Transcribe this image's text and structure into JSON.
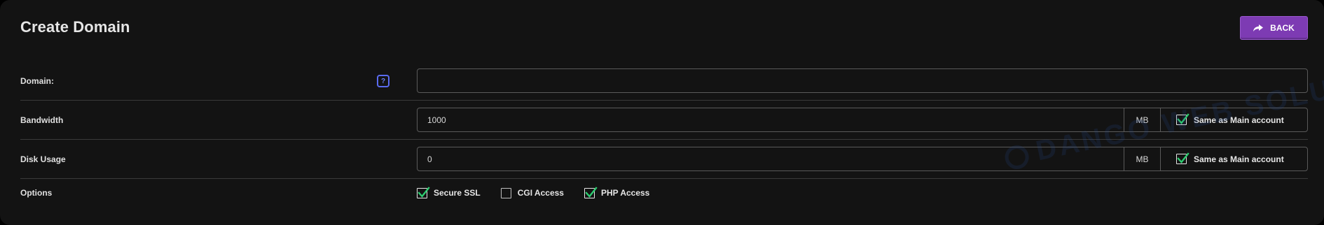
{
  "page": {
    "title": "Create Domain",
    "back_label": "BACK"
  },
  "form": {
    "domain": {
      "label": "Domain:",
      "help": "?",
      "value": ""
    },
    "bandwidth": {
      "label": "Bandwidth",
      "value": "1000",
      "unit": "MB",
      "same_as_label": "Same as Main account",
      "same_as_checked": true
    },
    "disk_usage": {
      "label": "Disk Usage",
      "value": "0",
      "unit": "MB",
      "same_as_label": "Same as Main account",
      "same_as_checked": true
    },
    "options": {
      "label": "Options",
      "items": [
        {
          "label": "Secure SSL",
          "checked": true
        },
        {
          "label": "CGI Access",
          "checked": false
        },
        {
          "label": "PHP Access",
          "checked": true
        }
      ]
    }
  },
  "watermark": "DANGO WEB SOLUTIONS",
  "colors": {
    "panel_bg": "#131313",
    "accent_purple": "#7d3bb3",
    "checkmark_green": "#2ecc71",
    "help_blue": "#5a6bf0"
  },
  "icons": {
    "back": "share-arrow-icon",
    "help": "question-icon",
    "check": "checkmark-icon"
  }
}
